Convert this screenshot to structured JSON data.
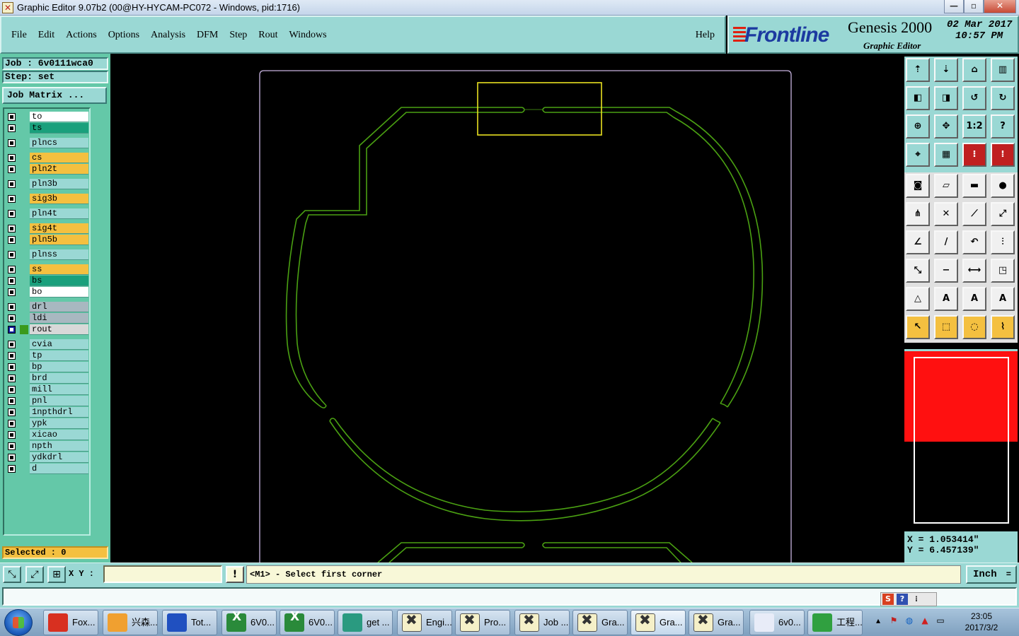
{
  "window": {
    "title": "Graphic Editor 9.07b2 (00@HY-HYCAM-PC072 - Windows, pid:1716)"
  },
  "menu": {
    "items": [
      "File",
      "Edit",
      "Actions",
      "Options",
      "Analysis",
      "DFM",
      "Step",
      "Rout",
      "Windows"
    ],
    "help": "Help"
  },
  "brand": {
    "logo": "Frontline",
    "product": "Genesis 2000",
    "subtitle": "Graphic Editor",
    "date": "02 Mar 2017",
    "time": "10:57 PM"
  },
  "job": {
    "job_line": "Job : 6v0111wca0",
    "step_line": "Step: set",
    "matrix_label": "Job Matrix ..."
  },
  "layers": [
    {
      "name": "to",
      "color": "#ffffff"
    },
    {
      "name": "ts",
      "color": "#1aa07c"
    },
    {
      "name": "plncs",
      "color": "#9ad8d4"
    },
    {
      "name": "cs",
      "color": "#f4c040"
    },
    {
      "name": "pln2t",
      "color": "#f4c040"
    },
    {
      "name": "pln3b",
      "color": "#9ad8d4"
    },
    {
      "name": "sig3b",
      "color": "#f4c040"
    },
    {
      "name": "pln4t",
      "color": "#9ad8d4"
    },
    {
      "name": "sig4t",
      "color": "#f4c040"
    },
    {
      "name": "pln5b",
      "color": "#f4c040"
    },
    {
      "name": "plnss",
      "color": "#9ad8d4"
    },
    {
      "name": "ss",
      "color": "#f4c040"
    },
    {
      "name": "bs",
      "color": "#1aa07c"
    },
    {
      "name": "bo",
      "color": "#ffffff"
    },
    {
      "name": "drl",
      "color": "#a8b8c0"
    },
    {
      "name": "ldi",
      "color": "#a8b8c0"
    },
    {
      "name": "rout",
      "color": "#d8d8d8",
      "selected": true,
      "mark": "#3a9a1c"
    },
    {
      "name": "cvia",
      "color": "#9ad8d4"
    },
    {
      "name": "tp",
      "color": "#9ad8d4"
    },
    {
      "name": "bp",
      "color": "#9ad8d4"
    },
    {
      "name": "brd",
      "color": "#9ad8d4"
    },
    {
      "name": "mill",
      "color": "#9ad8d4"
    },
    {
      "name": "pnl",
      "color": "#9ad8d4"
    },
    {
      "name": "1npthdrl",
      "color": "#9ad8d4"
    },
    {
      "name": "ypk",
      "color": "#9ad8d4"
    },
    {
      "name": "xicao",
      "color": "#9ad8d4"
    },
    {
      "name": "npth",
      "color": "#9ad8d4"
    },
    {
      "name": "ydkdrl",
      "color": "#9ad8d4"
    },
    {
      "name": "d",
      "color": "#9ad8d4"
    }
  ],
  "selected_label": "Selected : 0",
  "coords": {
    "x": "X = 1.053414\"",
    "y": "Y = 6.457139\""
  },
  "command": {
    "xy_label": "X Y :",
    "xy_value": "",
    "prompt": "<M1> - Select first corner",
    "unit": "Inch"
  },
  "colors": {
    "profile": "#c8b4e0",
    "rout": "#4aa012",
    "selection_box": "#e8e020"
  },
  "taskbar": {
    "items": [
      {
        "label": "Fox...",
        "icon": "foxit-icon"
      },
      {
        "label": "兴森...",
        "icon": "shell-icon"
      },
      {
        "label": "Tot...",
        "icon": "floppy-icon"
      },
      {
        "label": "6V0...",
        "icon": "excel-icon"
      },
      {
        "label": "6V0...",
        "icon": "excel-icon"
      },
      {
        "label": "get ...",
        "icon": "eye-icon"
      },
      {
        "label": "Engi...",
        "icon": "genesis-icon"
      },
      {
        "label": "Pro...",
        "icon": "genesis-icon"
      },
      {
        "label": "Job ...",
        "icon": "genesis-icon"
      },
      {
        "label": "Gra...",
        "icon": "genesis-icon"
      },
      {
        "label": "Gra...",
        "icon": "genesis-icon",
        "active": true
      },
      {
        "label": "Gra...",
        "icon": "genesis-icon"
      },
      {
        "label": "6v0...",
        "icon": "doc-icon"
      },
      {
        "label": "工程...",
        "icon": "app-icon"
      }
    ],
    "clock_time": "23:05",
    "clock_date": "2017/3/2"
  }
}
